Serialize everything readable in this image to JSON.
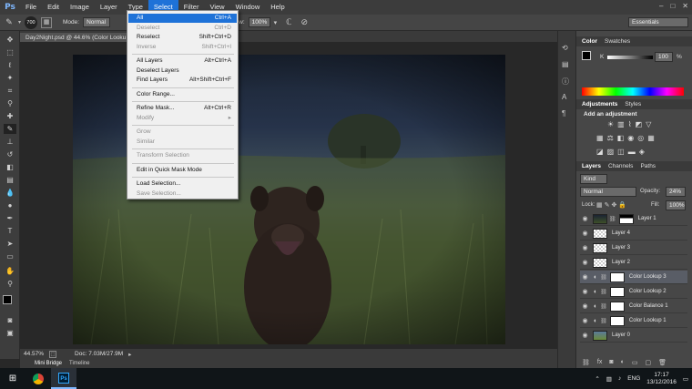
{
  "app": {
    "logo": "Ps"
  },
  "menubar": {
    "items": [
      "File",
      "Edit",
      "Image",
      "Layer",
      "Type",
      "Select",
      "Filter",
      "View",
      "Window",
      "Help"
    ],
    "active": "Select"
  },
  "window_controls": {
    "minimize": "–",
    "maximize": "□",
    "close": "✕"
  },
  "options": {
    "brush_size": "700",
    "mode_label": "Mode:",
    "mode_value": "Normal",
    "flow_label": "Flow:",
    "flow_value": "100%",
    "workspace": "Essentials"
  },
  "document": {
    "tab_title": "Day2Night.psd @ 44.6% (Color Looku",
    "zoom": "44.57%",
    "doc_info": "Doc: 7.03M/27.9M"
  },
  "bottom_tabs": [
    "Mini Bridge",
    "Timeline"
  ],
  "select_menu": [
    {
      "label": "All",
      "shortcut": "Ctrl+A",
      "state": "highlight"
    },
    {
      "label": "Deselect",
      "shortcut": "Ctrl+D",
      "state": "disabled"
    },
    {
      "label": "Reselect",
      "shortcut": "Shift+Ctrl+D",
      "state": "normal"
    },
    {
      "label": "Inverse",
      "shortcut": "Shift+Ctrl+I",
      "state": "disabled"
    },
    {
      "sep": true
    },
    {
      "label": "All Layers",
      "shortcut": "Alt+Ctrl+A",
      "state": "normal"
    },
    {
      "label": "Deselect Layers",
      "shortcut": "",
      "state": "normal"
    },
    {
      "label": "Find Layers",
      "shortcut": "Alt+Shift+Ctrl+F",
      "state": "normal"
    },
    {
      "sep": true
    },
    {
      "label": "Color Range...",
      "shortcut": "",
      "state": "normal"
    },
    {
      "sep": true
    },
    {
      "label": "Refine Mask...",
      "shortcut": "Alt+Ctrl+R",
      "state": "normal"
    },
    {
      "label": "Modify",
      "shortcut": "▸",
      "state": "disabled"
    },
    {
      "sep": true
    },
    {
      "label": "Grow",
      "shortcut": "",
      "state": "disabled"
    },
    {
      "label": "Similar",
      "shortcut": "",
      "state": "disabled"
    },
    {
      "sep": true
    },
    {
      "label": "Transform Selection",
      "shortcut": "",
      "state": "disabled"
    },
    {
      "sep": true
    },
    {
      "label": "Edit in Quick Mask Mode",
      "shortcut": "",
      "state": "normal"
    },
    {
      "sep": true
    },
    {
      "label": "Load Selection...",
      "shortcut": "",
      "state": "normal"
    },
    {
      "label": "Save Selection...",
      "shortcut": "",
      "state": "disabled"
    }
  ],
  "color_panel": {
    "tabs": [
      "Color",
      "Swatches"
    ],
    "channel": "K",
    "value": "100",
    "unit": "%"
  },
  "adjustments_panel": {
    "tabs": [
      "Adjustments",
      "Styles"
    ],
    "heading": "Add an adjustment"
  },
  "layers_panel": {
    "tabs": [
      "Layers",
      "Channels",
      "Paths"
    ],
    "filter": "Kind",
    "blend_mode": "Normal",
    "opacity_label": "Opacity:",
    "opacity": "24%",
    "lock_label": "Lock:",
    "fill_label": "Fill:",
    "fill": "100%",
    "layers": [
      {
        "name": "Layer 1",
        "type": "image-mask",
        "selected": false
      },
      {
        "name": "Layer 4",
        "type": "transparent",
        "selected": false
      },
      {
        "name": "Layer 3",
        "type": "transparent",
        "selected": false
      },
      {
        "name": "Layer 2",
        "type": "transparent",
        "selected": false
      },
      {
        "name": "Color Lookup 3",
        "type": "adjustment",
        "selected": true
      },
      {
        "name": "Color Lookup 2",
        "type": "adjustment",
        "selected": false
      },
      {
        "name": "Color Balance 1",
        "type": "adjustment",
        "selected": false
      },
      {
        "name": "Color Lookup 1",
        "type": "adjustment",
        "selected": false
      },
      {
        "name": "Layer 0",
        "type": "photo",
        "selected": false
      }
    ]
  },
  "taskbar": {
    "language": "ENG",
    "time": "17:17",
    "date": "13/12/2016"
  },
  "colors": {
    "menu_highlight": "#1e72d8",
    "panel_bg": "#474747",
    "canvas_bg": "#282828"
  }
}
